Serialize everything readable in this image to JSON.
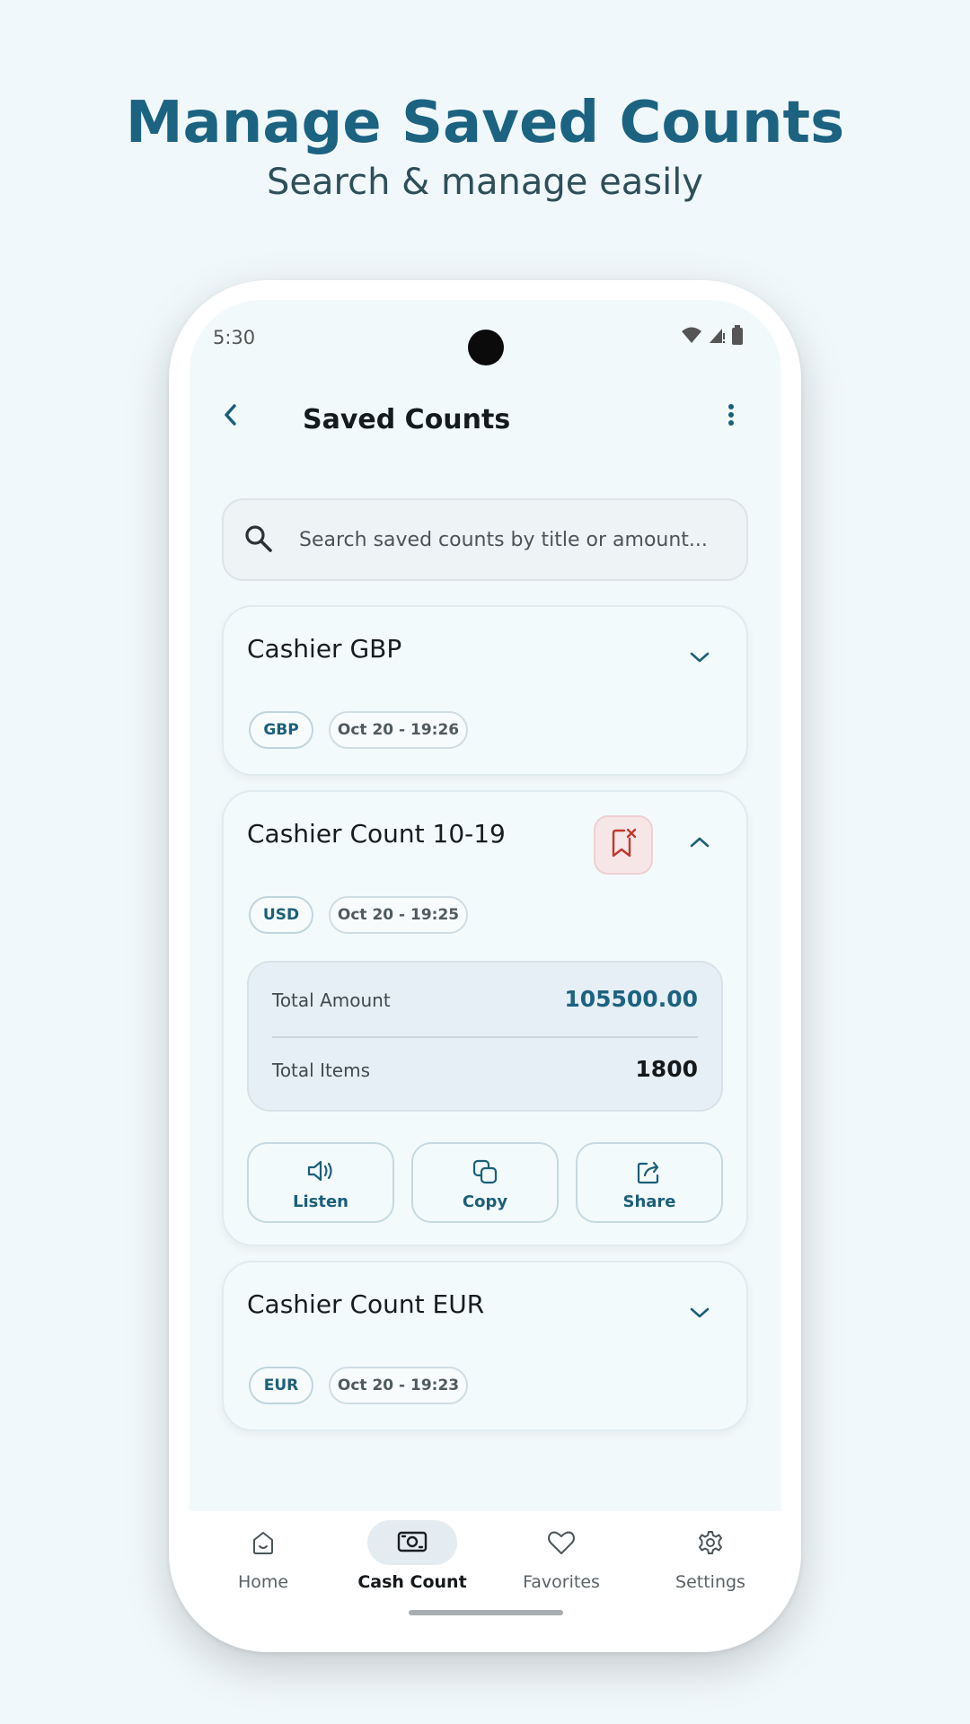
{
  "promo": {
    "title": "Manage Saved Counts",
    "subtitle": "Search & manage easily"
  },
  "status_bar": {
    "time": "5:30",
    "icons": [
      "wifi-icon",
      "signal-icon",
      "battery-icon"
    ]
  },
  "app_bar": {
    "title": "Saved Counts",
    "back_icon": "chevron-left-icon",
    "more_icon": "more-vertical-icon"
  },
  "search": {
    "placeholder": "Search saved counts by title or amount..."
  },
  "counts": [
    {
      "title": "Cashier GBP",
      "currency": "GBP",
      "date": "Oct 20 - 19:26",
      "expanded": false
    },
    {
      "title": "Cashier Count 10-19",
      "currency": "USD",
      "date": "Oct 20 - 19:25",
      "expanded": true,
      "total_amount_label": "Total Amount",
      "total_amount": "105500.00",
      "total_items_label": "Total Items",
      "total_items": "1800",
      "actions": [
        {
          "label": "Listen",
          "icon": "speaker-icon"
        },
        {
          "label": "Copy",
          "icon": "copy-icon"
        },
        {
          "label": "Share",
          "icon": "share-icon"
        }
      ]
    },
    {
      "title": "Cashier Count EUR",
      "currency": "EUR",
      "date": "Oct 20 - 19:23",
      "expanded": false
    }
  ],
  "bottom_nav": {
    "items": [
      {
        "label": "Home",
        "icon": "home-icon",
        "active": false
      },
      {
        "label": "Cash Count",
        "icon": "banknote-icon",
        "active": true
      },
      {
        "label": "Favorites",
        "icon": "heart-icon",
        "active": false
      },
      {
        "label": "Settings",
        "icon": "gear-icon",
        "active": false
      }
    ]
  },
  "colors": {
    "accent": "#1b6381",
    "background": "#f1f8fb",
    "danger": "#c0392b"
  }
}
